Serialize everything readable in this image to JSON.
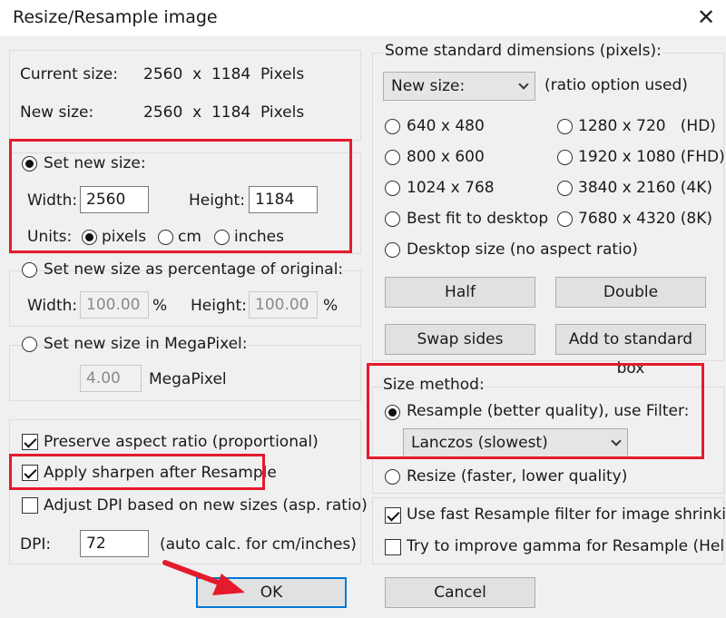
{
  "window": {
    "title": "Resize/Resample image",
    "close_glyph": "✕"
  },
  "size_info": {
    "current_label": "Current size:",
    "current_value": "2560  x  1184  Pixels",
    "new_label": "New size:",
    "new_value": "2560  x  1184  Pixels"
  },
  "set_new_size": {
    "label": "Set new size:",
    "selected": true,
    "width_label": "Width:",
    "width_value": "2560",
    "height_label": "Height:",
    "height_value": "1184",
    "units_label": "Units:",
    "units": [
      {
        "label": "pixels",
        "selected": true
      },
      {
        "label": "cm",
        "selected": false
      },
      {
        "label": "inches",
        "selected": false
      }
    ]
  },
  "percentage": {
    "label": "Set new size as percentage of original:",
    "width_label": "Width:",
    "width_value": "100.00",
    "height_label": "Height:",
    "height_value": "100.00",
    "unit": "%"
  },
  "megapixel": {
    "label": "Set new size in MegaPixel:",
    "value": "4.00",
    "unit": "MegaPixel"
  },
  "options": {
    "preserve_aspect": {
      "label": "Preserve aspect ratio (proportional)",
      "checked": true
    },
    "apply_sharpen": {
      "label": "Apply sharpen after Resample",
      "checked": true
    },
    "adjust_dpi": {
      "label": "Adjust DPI based on new sizes (asp. ratio)",
      "checked": false
    },
    "dpi_label": "DPI:",
    "dpi_value": "72",
    "dpi_note": "(auto calc. for cm/inches)"
  },
  "standard_dims": {
    "heading": "Some standard dimensions (pixels):",
    "select_value": "New size:",
    "select_note": "(ratio option used)",
    "options": [
      "640 x 480",
      "1280 x 720   (HD)",
      "800 x 600",
      "1920 x 1080 (FHD)",
      "1024 x 768",
      "3840 x 2160 (4K)",
      "Best fit to desktop",
      "7680 x 4320 (8K)",
      "Desktop size (no aspect ratio)"
    ],
    "half_label": "Half",
    "double_label": "Double",
    "swap_label": "Swap sides",
    "add_standard_label": "Add to standard box"
  },
  "size_method": {
    "heading": "Size method:",
    "resample_label": "Resample (better quality), use Filter:",
    "resample_selected": true,
    "filter_value": "Lanczos (slowest)",
    "resize_label": "Resize (faster, lower quality)",
    "resize_selected": false
  },
  "resample_options": {
    "fast_resample": {
      "label": "Use fast Resample filter for image shrinking",
      "checked": true
    },
    "gamma": {
      "label": "Try to improve gamma for Resample (Help file",
      "checked": false
    }
  },
  "footer": {
    "ok_label": "OK",
    "cancel_label": "Cancel"
  },
  "colors": {
    "highlight": "#e41b2c",
    "accent": "#0078d7",
    "background": "#f0f0f0"
  }
}
